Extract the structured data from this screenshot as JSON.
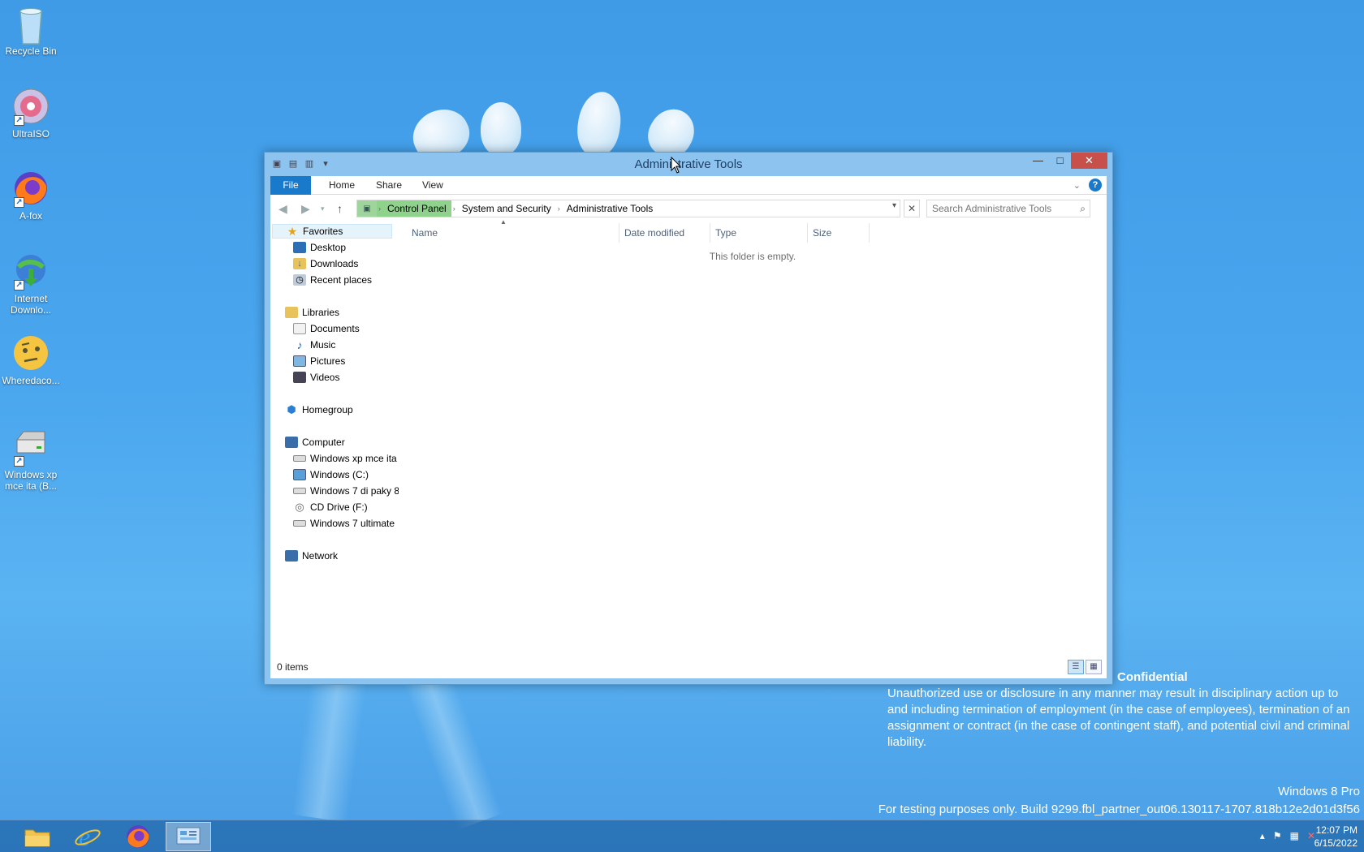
{
  "desktop": {
    "icons": [
      {
        "label": "Recycle Bin",
        "icon": "recycle-bin-icon"
      },
      {
        "label": "UltraISO",
        "icon": "disc-icon"
      },
      {
        "label": "A-fox",
        "icon": "firefox-icon"
      },
      {
        "label": "Internet Downlo...",
        "icon": "internet-download-manager-icon"
      },
      {
        "label": "Wheredaco...",
        "icon": "thinking-face-icon"
      },
      {
        "label": "Windows xp mce ita (B...",
        "icon": "drive-icon"
      }
    ]
  },
  "window": {
    "title": "Administrative Tools",
    "ribbon_tabs": [
      "File",
      "Home",
      "Share",
      "View"
    ],
    "breadcrumb": [
      "Control Panel",
      "System and Security",
      "Administrative Tools"
    ],
    "search_placeholder": "Search Administrative Tools",
    "nav": {
      "favorites": {
        "label": "Favorites",
        "items": [
          "Desktop",
          "Downloads",
          "Recent places"
        ]
      },
      "libraries": {
        "label": "Libraries",
        "items": [
          "Documents",
          "Music",
          "Pictures",
          "Videos"
        ]
      },
      "homegroup": "Homegroup",
      "computer": {
        "label": "Computer",
        "items": [
          "Windows xp mce ita",
          "Windows (C:)",
          "Windows 7 di paky 8",
          "CD Drive (F:)",
          "Windows 7 ultimate"
        ]
      },
      "network": "Network"
    },
    "columns": [
      "Name",
      "Date modified",
      "Type",
      "Size"
    ],
    "empty_message": "This folder is empty.",
    "status": "0 items"
  },
  "watermark": {
    "heading": "Confidential",
    "body": "Unauthorized use or disclosure in any manner may result in disciplinary action up to and including termination of employment (in the case of employees), termination of an assignment or contract (in the case of contingent staff), and potential civil and criminal liability.",
    "edition": "Windows 8 Pro",
    "build": "For testing purposes only. Build 9299.fbl_partner_out06.130117-1707.818b12e2d01d3f56"
  },
  "taskbar": {
    "apps": [
      "file-explorer-icon",
      "internet-explorer-icon",
      "firefox-icon",
      "control-panel-icon"
    ],
    "time": "12:07 PM",
    "date": "6/15/2022"
  },
  "colors": {
    "accent": "#1979ca",
    "breadcrumb_highlight": "#8fd28c",
    "close": "#c7504a"
  }
}
